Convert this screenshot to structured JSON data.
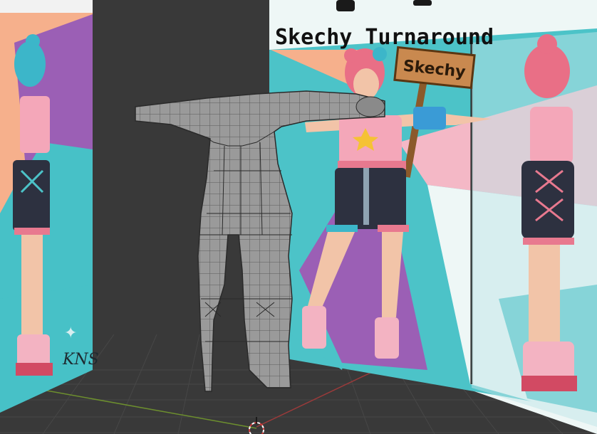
{
  "viewport": {
    "title": "Skechy Turnaround",
    "sign_label": "Skechy",
    "signature": "KNS"
  },
  "colors": {
    "background": "#393939",
    "grid": "#4a4a4a",
    "x_axis": "#9b3a3a",
    "y_axis": "#6d8f2e",
    "mesh_fill": "#9a9a9a",
    "mesh_wire": "#2a2a2a",
    "hair": "#e96f86",
    "hair_side": "#3cb6c9",
    "shirt": "#f4a7b9",
    "shorts": "#2d3140",
    "skin": "#f2c4a8",
    "backdrop_teal": "#4cc3c8",
    "backdrop_purple": "#9b5fb5",
    "backdrop_peach": "#f6b08c"
  }
}
